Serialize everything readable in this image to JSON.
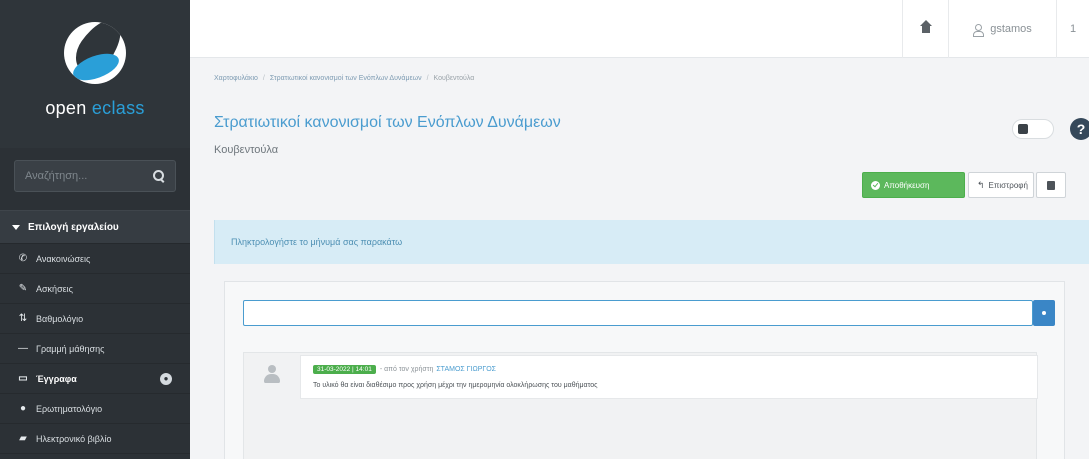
{
  "sidebar": {
    "logo_text_main": "open ",
    "logo_text_accent": "eclass",
    "search_placeholder": "Αναζήτηση...",
    "section_title": "Επιλογή εργαλείου",
    "items": [
      {
        "label": "Ανακοινώσεις",
        "icon": "bullhorn-icon",
        "glyph": "✆"
      },
      {
        "label": "Ασκήσεις",
        "icon": "edit-icon",
        "glyph": "✎"
      },
      {
        "label": "Βαθμολόγιο",
        "icon": "sort-icon",
        "glyph": "⇅"
      },
      {
        "label": "Γραμμή μάθησης",
        "icon": "minus-icon",
        "glyph": "―"
      },
      {
        "label": "Έγγραφα",
        "icon": "folder-icon",
        "glyph": "▭",
        "badge": "●"
      },
      {
        "label": "Ερωτηματολόγιο",
        "icon": "question-icon",
        "glyph": "●"
      },
      {
        "label": "Ηλεκτρονικό βιβλίο",
        "icon": "book-icon",
        "glyph": "▰"
      }
    ]
  },
  "topbar": {
    "username": "gstamos",
    "extra": "1"
  },
  "main": {
    "breadcrumb": [
      "Χαρτοφυλάκιο",
      "Στρατιωτικοί κανονισμοί των Ενόπλων Δυνάμεων",
      "Κουβεντούλα"
    ],
    "title": "Στρατιωτικοί κανονισμοί των Ενόπλων Δυνάμεων",
    "subtitle": "Κουβεντούλα",
    "buttons": {
      "save_label": "Αποθήκευση",
      "back_label": "Επιστροφή"
    },
    "info_text": "Πληκτρολογήστε το μήνυμά σας παρακάτω",
    "message_input_value": "",
    "message": {
      "date_badge": "31-03-2022 | 14:01",
      "by_text": "- από τον χρήστη",
      "user": "ΣΤΑΜΟΣ ΓΙΩΡΓΟΣ",
      "body": "Το υλικό θα είναι διαθέσιμο προς χρήση μέχρι την ημερομηνία ολοκλήρωσης του μαθήματος"
    }
  },
  "colors": {
    "sidebar_bg": "#2c3136",
    "accent_blue": "#4a9ccf",
    "save_green": "#5cb85c",
    "info_bg": "#d7ecf6"
  }
}
